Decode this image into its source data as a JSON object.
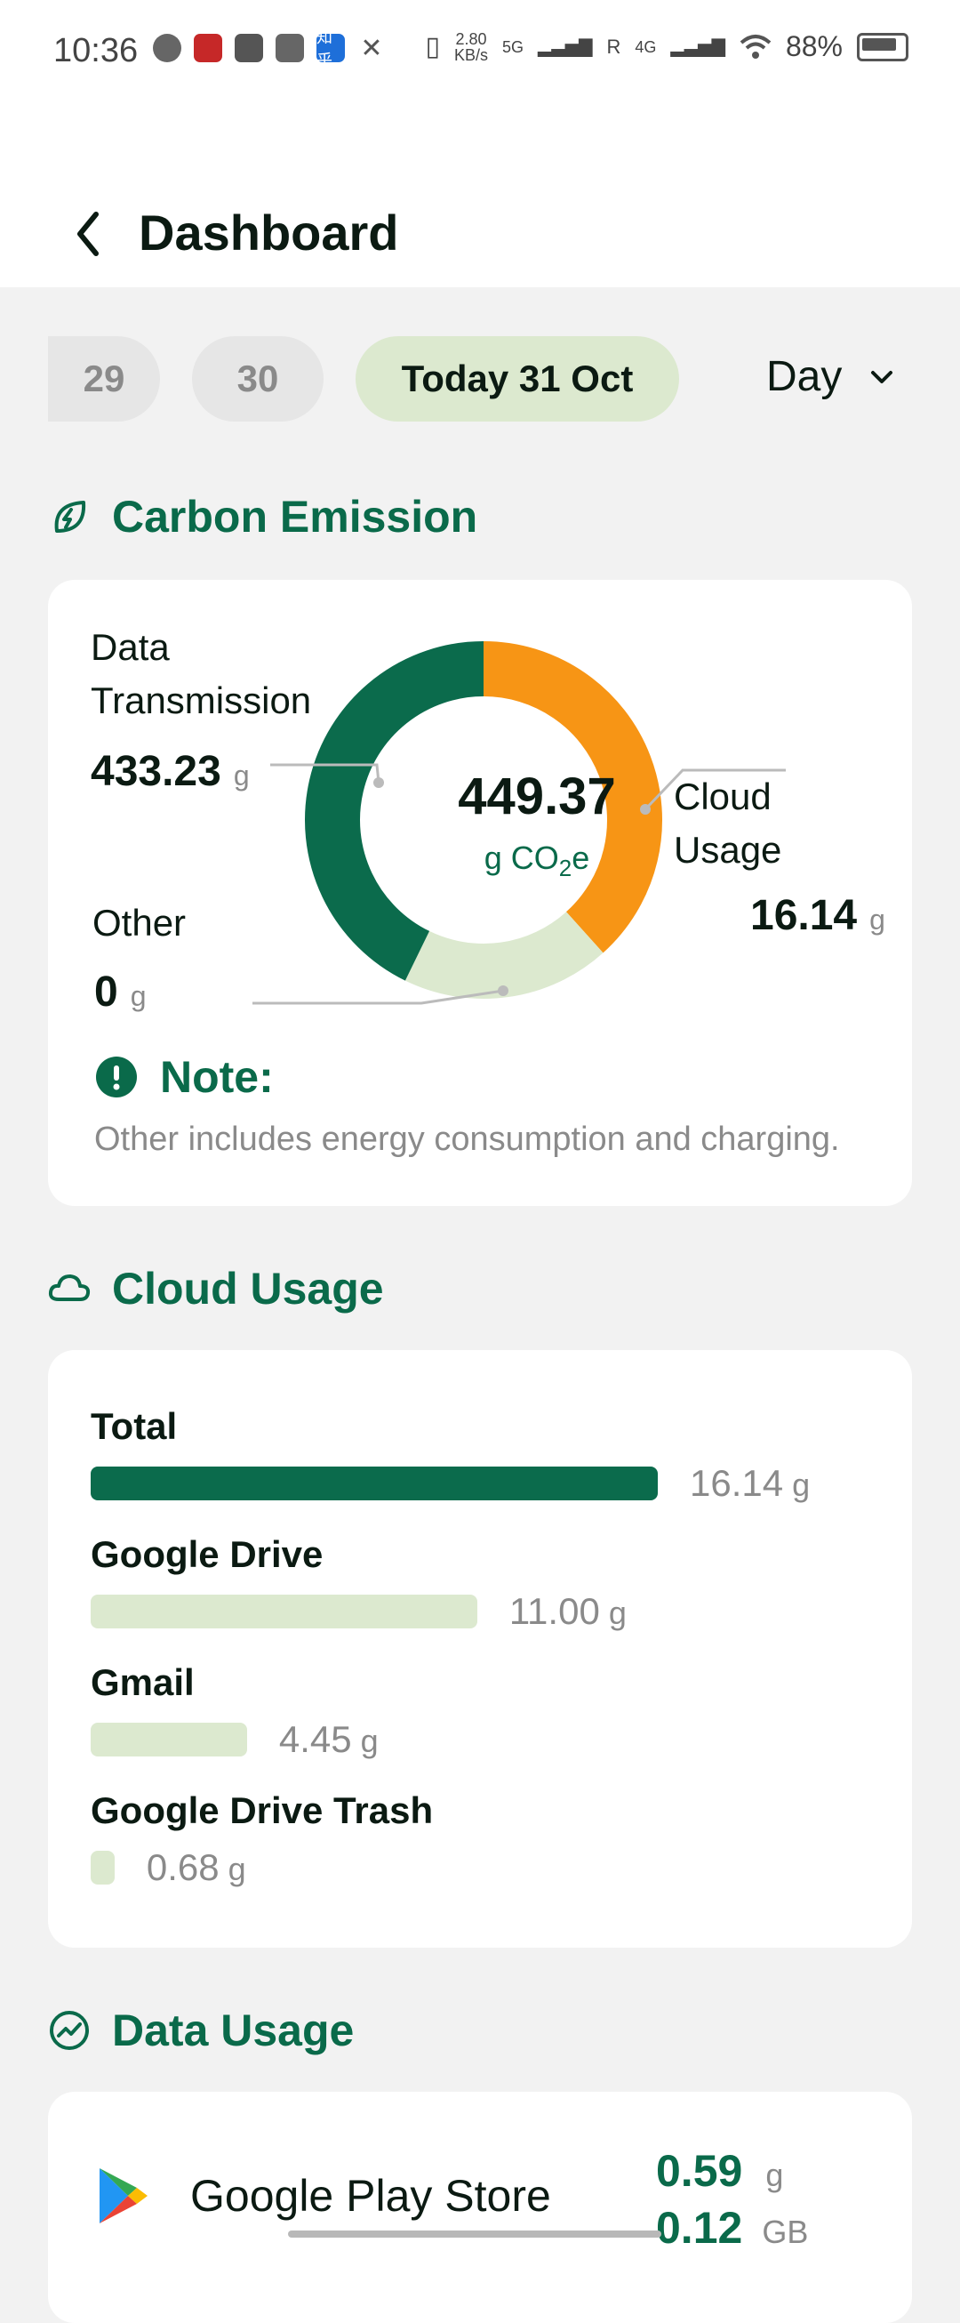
{
  "status_bar": {
    "time": "10:36",
    "net_speed_value": "2.80",
    "net_speed_unit": "KB/s",
    "net_5g": "5G",
    "net_4g": "4G",
    "roaming": "R",
    "battery": "88%",
    "left_icons": [
      "wechat-icon",
      "app-red-icon",
      "app-mail-icon",
      "email-icon",
      "zhihu-icon",
      "tools-icon"
    ],
    "zhihu_label": "知乎"
  },
  "header": {
    "title": "Dashboard"
  },
  "date_selector": {
    "dates": [
      "29",
      "30"
    ],
    "selected": "Today 31 Oct",
    "period": "Day"
  },
  "carbon": {
    "title": "Carbon Emission",
    "total": "449.37",
    "unit_prefix": "g CO",
    "unit_sub": "2",
    "unit_suffix": "e",
    "data_transmission": {
      "label_line1": "Data",
      "label_line2": "Transmission",
      "value": "433.23",
      "unit": "g"
    },
    "cloud_usage": {
      "label_line1": "Cloud",
      "label_line2": "Usage",
      "value": "16.14",
      "unit": "g"
    },
    "other": {
      "label": "Other",
      "value": "0",
      "unit": "g"
    },
    "note_title": "Note:",
    "note_text": "Other includes energy consumption and charging.",
    "colors": {
      "data_transmission": "#0b6b4c",
      "cloud_usage": "#f79515",
      "other": "#dce9cf"
    }
  },
  "cloud_usage": {
    "title": "Cloud Usage",
    "items": [
      {
        "name": "Total",
        "value": "16.14",
        "unit": "g",
        "amount": 16.14,
        "color": "#0b6b4c"
      },
      {
        "name": "Google Drive",
        "value": "11.00",
        "unit": "g",
        "amount": 11.0,
        "color": "#dce9cf"
      },
      {
        "name": "Gmail",
        "value": "4.45",
        "unit": "g",
        "amount": 4.45,
        "color": "#dce9cf"
      },
      {
        "name": "Google Drive Trash",
        "value": "0.68",
        "unit": "g",
        "amount": 0.68,
        "color": "#dce9cf"
      }
    ]
  },
  "data_usage": {
    "title": "Data Usage",
    "apps": [
      {
        "name": "Google Play Store",
        "emission": "0.59",
        "emission_unit": "g",
        "data": "0.12",
        "data_unit": "GB"
      }
    ]
  }
}
